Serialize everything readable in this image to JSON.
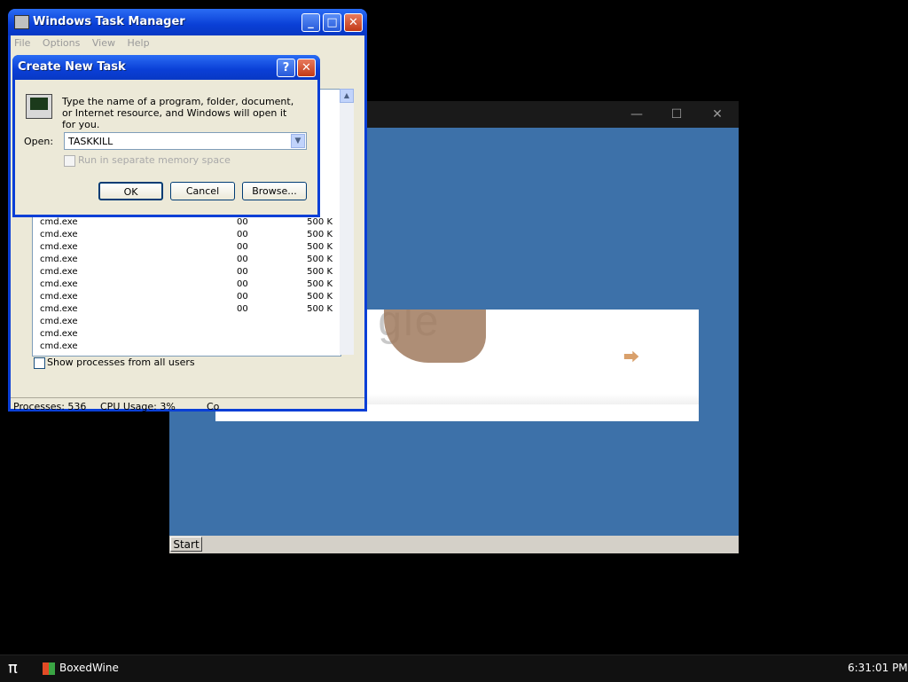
{
  "boxedwine_window": {
    "controls": {
      "minimize": "—",
      "maximize": "☐",
      "close": "✕"
    },
    "taskbar": {
      "start_label": "Start"
    }
  },
  "task_manager": {
    "title": "Windows Task Manager",
    "menu": [
      "File",
      "Options",
      "View",
      "Help"
    ],
    "processes": [
      {
        "name": "cmd.exe",
        "cpu": "00",
        "mem": "500 K"
      },
      {
        "name": "cmd.exe",
        "cpu": "00",
        "mem": "500 K"
      },
      {
        "name": "cmd.exe",
        "cpu": "00",
        "mem": "500 K"
      },
      {
        "name": "cmd.exe",
        "cpu": "00",
        "mem": "500 K"
      },
      {
        "name": "cmd.exe",
        "cpu": "00",
        "mem": "500 K"
      },
      {
        "name": "cmd.exe",
        "cpu": "00",
        "mem": "500 K"
      },
      {
        "name": "cmd.exe",
        "cpu": "00",
        "mem": "500 K"
      },
      {
        "name": "cmd.exe",
        "cpu": "00",
        "mem": "500 K"
      },
      {
        "name": "cmd.exe",
        "cpu": "",
        "mem": ""
      },
      {
        "name": "cmd.exe",
        "cpu": "",
        "mem": ""
      },
      {
        "name": "cmd.exe",
        "cpu": "",
        "mem": ""
      }
    ],
    "show_all_label": "Show processes from all users",
    "status": {
      "processes": "Processes: 536",
      "cpu": "CPU Usage: 3%",
      "commit": "Co"
    }
  },
  "create_task_dialog": {
    "title": "Create New Task",
    "message": "Type the name of a program, folder, document, or Internet resource, and Windows will open it for you.",
    "open_label": "Open:",
    "open_value": "TASKKILL",
    "separate_memory_label": "Run in separate memory space",
    "ok_label": "OK",
    "cancel_label": "Cancel",
    "browse_label": "Browse..."
  },
  "doodle": {
    "letters": "Go  gle"
  },
  "host_taskbar": {
    "pi_glyph": "π",
    "app_label": "BoxedWine",
    "clock": "6:31:01 PM"
  }
}
